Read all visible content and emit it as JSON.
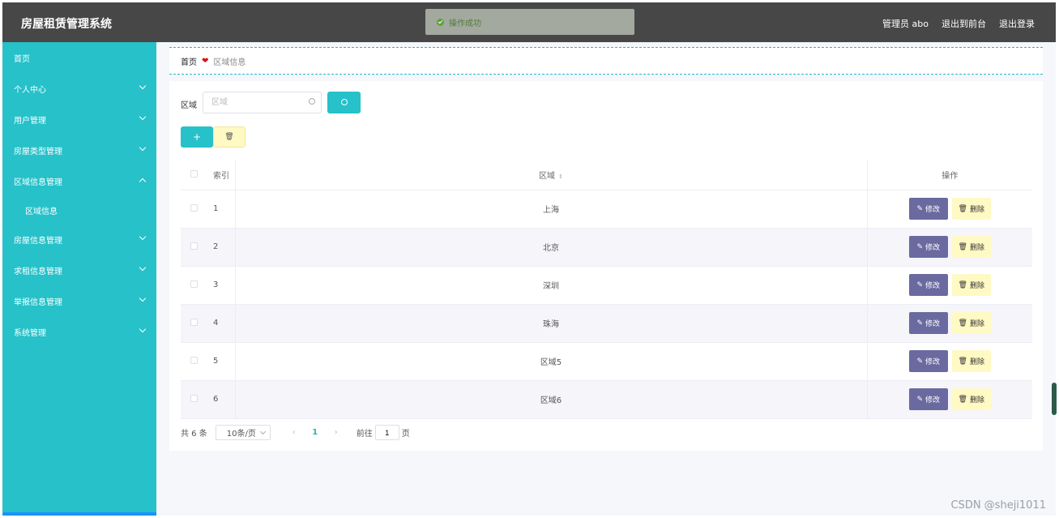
{
  "header": {
    "app_title": "房屋租赁管理系统",
    "user": "管理员 abo",
    "front_link": "退出到前台",
    "logout": "退出登录"
  },
  "toast": {
    "message": "操作成功"
  },
  "sidebar": {
    "items": [
      {
        "label": "首页"
      },
      {
        "label": "个人中心"
      },
      {
        "label": "用户管理"
      },
      {
        "label": "房屋类型管理"
      },
      {
        "label": "区域信息管理"
      },
      {
        "label": "区域信息"
      },
      {
        "label": "房屋信息管理"
      },
      {
        "label": "求租信息管理"
      },
      {
        "label": "举报信息管理"
      },
      {
        "label": "系统管理"
      }
    ]
  },
  "breadcrumb": {
    "home": "首页",
    "separator": "❤",
    "current": "区域信息"
  },
  "search": {
    "label": "区域",
    "placeholder": "区域"
  },
  "actions": {
    "add": "+",
    "delete": "🗑"
  },
  "table": {
    "headers": {
      "index": "索引",
      "area": "区域",
      "ops": "操作"
    },
    "edit_label": "修改",
    "delete_label": "删除",
    "rows": [
      {
        "index": "1",
        "area": "上海"
      },
      {
        "index": "2",
        "area": "北京"
      },
      {
        "index": "3",
        "area": "深圳"
      },
      {
        "index": "4",
        "area": "珠海"
      },
      {
        "index": "5",
        "area": "区域5"
      },
      {
        "index": "6",
        "area": "区域6"
      }
    ]
  },
  "pagination": {
    "total": "共 6 条",
    "page_size": "10条/页",
    "current_page": "1",
    "goto_prefix": "前往",
    "goto_value": "1",
    "goto_suffix": "页"
  },
  "watermark": "CSDN @sheji1011",
  "colors": {
    "sidebar": "#26c1c9",
    "header": "#474747",
    "edit_button": "#6a6aa0",
    "delete_button": "#fff9c4"
  }
}
